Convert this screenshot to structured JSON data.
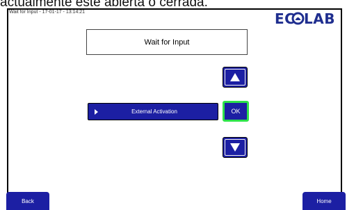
{
  "caption": "actualmente este abierta o cerrada.",
  "status_bar": {
    "text": "Wait for Input - 17-01-17 - 13:14:21"
  },
  "logo": {
    "text": "ECOLAB",
    "color": "#1f2e8f"
  },
  "screen": {
    "title": "Wait for Input",
    "up_icon": "up-arrow-icon",
    "down_icon": "down-arrow-icon",
    "selected_item": {
      "label": "External Activation",
      "icon": "chevron-right-icon"
    },
    "ok_label": "OK"
  },
  "footer": {
    "back_label": "Back",
    "home_label": "Home"
  },
  "colors": {
    "button_blue": "#1c1fa3",
    "ok_border": "#2ee24a"
  }
}
